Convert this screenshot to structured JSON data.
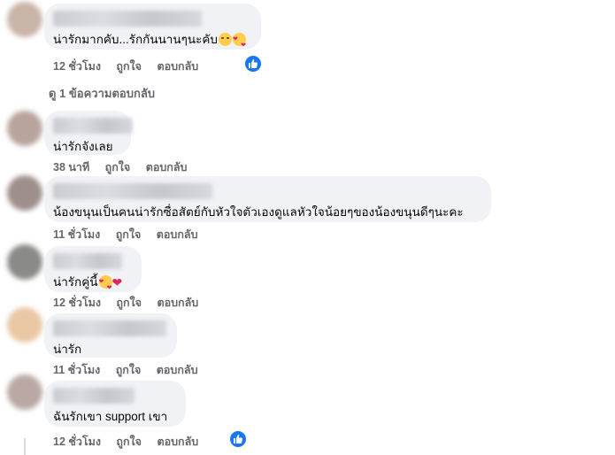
{
  "comments": [
    {
      "text": "น่ารักมากคับ...รักกันนานๆนะคับ",
      "emoji": [
        "smile-emoji",
        "heart-face-emoji"
      ],
      "time": "12 ชั่วโมง",
      "like": "ถูกใจ",
      "reply": "ตอบกลับ",
      "reaction": "like-icon",
      "avatar_color": "#c9b4a8"
    },
    {
      "text": "น่ารักจังเลย",
      "time": "38 นาที",
      "like": "ถูกใจ",
      "reply": "ตอบกลับ",
      "avatar_color": "#b8a49c"
    },
    {
      "text": "น้องขนุนเป็นคนน่ารักซื่อสัตย์กับหัวใจตัวเองดูแลหัวใจน้อยๆของน้องขนุนดีๆนะคะ",
      "time": "11 ชั่วโมง",
      "like": "ถูกใจ",
      "reply": "ตอบกลับ",
      "avatar_color": "#9e8f8c"
    },
    {
      "text": "น่ารักคู่นี้",
      "emoji": [
        "heart-face-emoji",
        "red-heart-emoji"
      ],
      "time": "12 ชั่วโมง",
      "like": "ถูกใจ",
      "reply": "ตอบกลับ",
      "avatar_color": "#8a8a88"
    },
    {
      "text": "น่ารัก",
      "time": "11 ชั่วโมง",
      "like": "ถูกใจ",
      "reply": "ตอบกลับ",
      "avatar_color": "#e9c7a3"
    },
    {
      "text": "ฉันรักเขา support เขา",
      "time": "12 ชั่วโมง",
      "like": "ถูกใจ",
      "reply": "ตอบกลับ",
      "reaction": "like-icon",
      "avatar_color": "#b9a8a4"
    }
  ],
  "view_replies": "ดู 1 ข้อความตอบกลับ",
  "colors": {
    "bubble": "#f0f2f5",
    "meta": "#65676b",
    "like_blue": "#1877f2"
  }
}
